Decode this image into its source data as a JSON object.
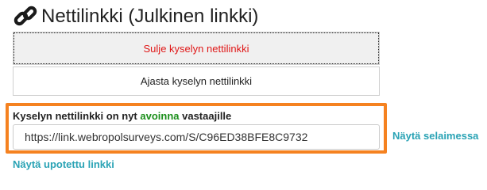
{
  "header": {
    "title": "Nettilinkki (Julkinen linkki)",
    "icon": "chain-link-icon"
  },
  "buttons": {
    "close_link": "Sulje kyselyn nettilinkki",
    "schedule_link": "Ajasta kyselyn nettilinkki"
  },
  "status": {
    "prefix": "Kyselyn nettilinkki on nyt ",
    "state": "avoinna",
    "suffix": " vastaajille"
  },
  "link": {
    "url": "https://link.webropolsurveys.com/S/C96ED38BFE8C9732"
  },
  "actions": {
    "view_in_browser": "Näytä selaimessa",
    "view_embedded": "Näytä upotettu linkki"
  },
  "colors": {
    "close_text": "#e01818",
    "open_state": "#1a8f1a",
    "highlight_border": "#f58220",
    "link_text": "#2aa3b5"
  }
}
